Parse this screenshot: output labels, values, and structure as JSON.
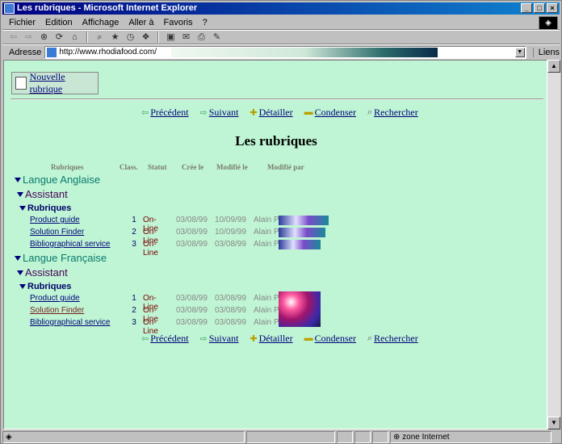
{
  "window": {
    "title": "Les rubriques - Microsoft Internet Explorer",
    "min": "_",
    "max": "□",
    "close": "×"
  },
  "menu": [
    "Fichier",
    "Edition",
    "Affichage",
    "Aller à",
    "Favoris",
    "?"
  ],
  "address": {
    "label": "Adresse",
    "url": "http://www.rhodiafood.com/",
    "links": "Liens"
  },
  "page": {
    "new_button": "Nouvelle rubrique",
    "nav": {
      "prev": "Précédent",
      "next": "Suivant",
      "detail": "Détailler",
      "condense": "Condenser",
      "search": "Rechercher"
    },
    "title": "Les rubriques",
    "columns": {
      "rubriques": "Rubriques",
      "class": "Class.",
      "statut": "Statut",
      "cree": "Crée le",
      "modifie": "Modifié le",
      "par": "Modifié par"
    },
    "sections": [
      {
        "label": "Langue Anglaise",
        "sub": "Assistant",
        "group": "Rubriques",
        "rows": [
          {
            "name": "Product guide",
            "cls": "1",
            "stat": "On-Line",
            "cree": "03/08/99",
            "modif": "10/09/99",
            "par": "Alain P"
          },
          {
            "name": "Solution Finder",
            "cls": "2",
            "stat": "On-Line",
            "cree": "03/08/99",
            "modif": "10/09/99",
            "par": "Alain P"
          },
          {
            "name": "Bibliographical service",
            "cls": "3",
            "stat": "On-Line",
            "cree": "03/08/99",
            "modif": "03/08/99",
            "par": "Alain P"
          }
        ]
      },
      {
        "label": "Langue Française",
        "sub": "Assistant",
        "group": "Rubriques",
        "rows": [
          {
            "name": "Product guide",
            "cls": "1",
            "stat": "On-Line",
            "cree": "03/08/99",
            "modif": "03/08/99",
            "par": "Alain P"
          },
          {
            "name": "Solution Finder",
            "cls": "2",
            "stat": "On-Line",
            "cree": "03/08/99",
            "modif": "03/08/99",
            "par": "Alain P"
          },
          {
            "name": "Bibliographical service",
            "cls": "3",
            "stat": "On-Line",
            "cree": "03/08/99",
            "modif": "03/08/99",
            "par": "Alain P"
          }
        ]
      }
    ]
  },
  "status": {
    "zone": "zone Internet"
  },
  "colors": {
    "page_bg": "#bff5d4",
    "title_bar": "#000080"
  }
}
